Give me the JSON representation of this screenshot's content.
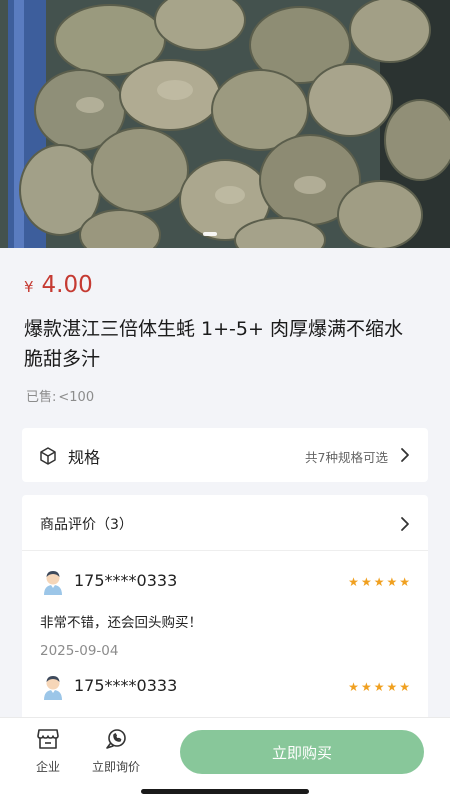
{
  "product": {
    "currency": "¥",
    "price": "4.00",
    "title": "爆款湛江三倍体生蚝 1+-5+ 肉厚爆满不缩水 脆甜多汁",
    "sold_label": "已售:",
    "sold_value": "<100"
  },
  "spec": {
    "label": "规格",
    "hint": "共7种规格可选",
    "icon": "cube-icon"
  },
  "reviews": {
    "header": "商品评价（3）",
    "items": [
      {
        "user": "175****0333",
        "rating": 5,
        "text": "非常不错，还会回头购买！",
        "date": "2025-09-04"
      },
      {
        "user": "175****0333",
        "rating": 5,
        "text": "",
        "date": ""
      }
    ]
  },
  "bottom_bar": {
    "company_label": "企业",
    "ask_label": "立即询价",
    "buy_label": "立即购买"
  },
  "colors": {
    "price": "#c53a32",
    "buy_button": "#88c79a",
    "star": "#f0a020"
  }
}
